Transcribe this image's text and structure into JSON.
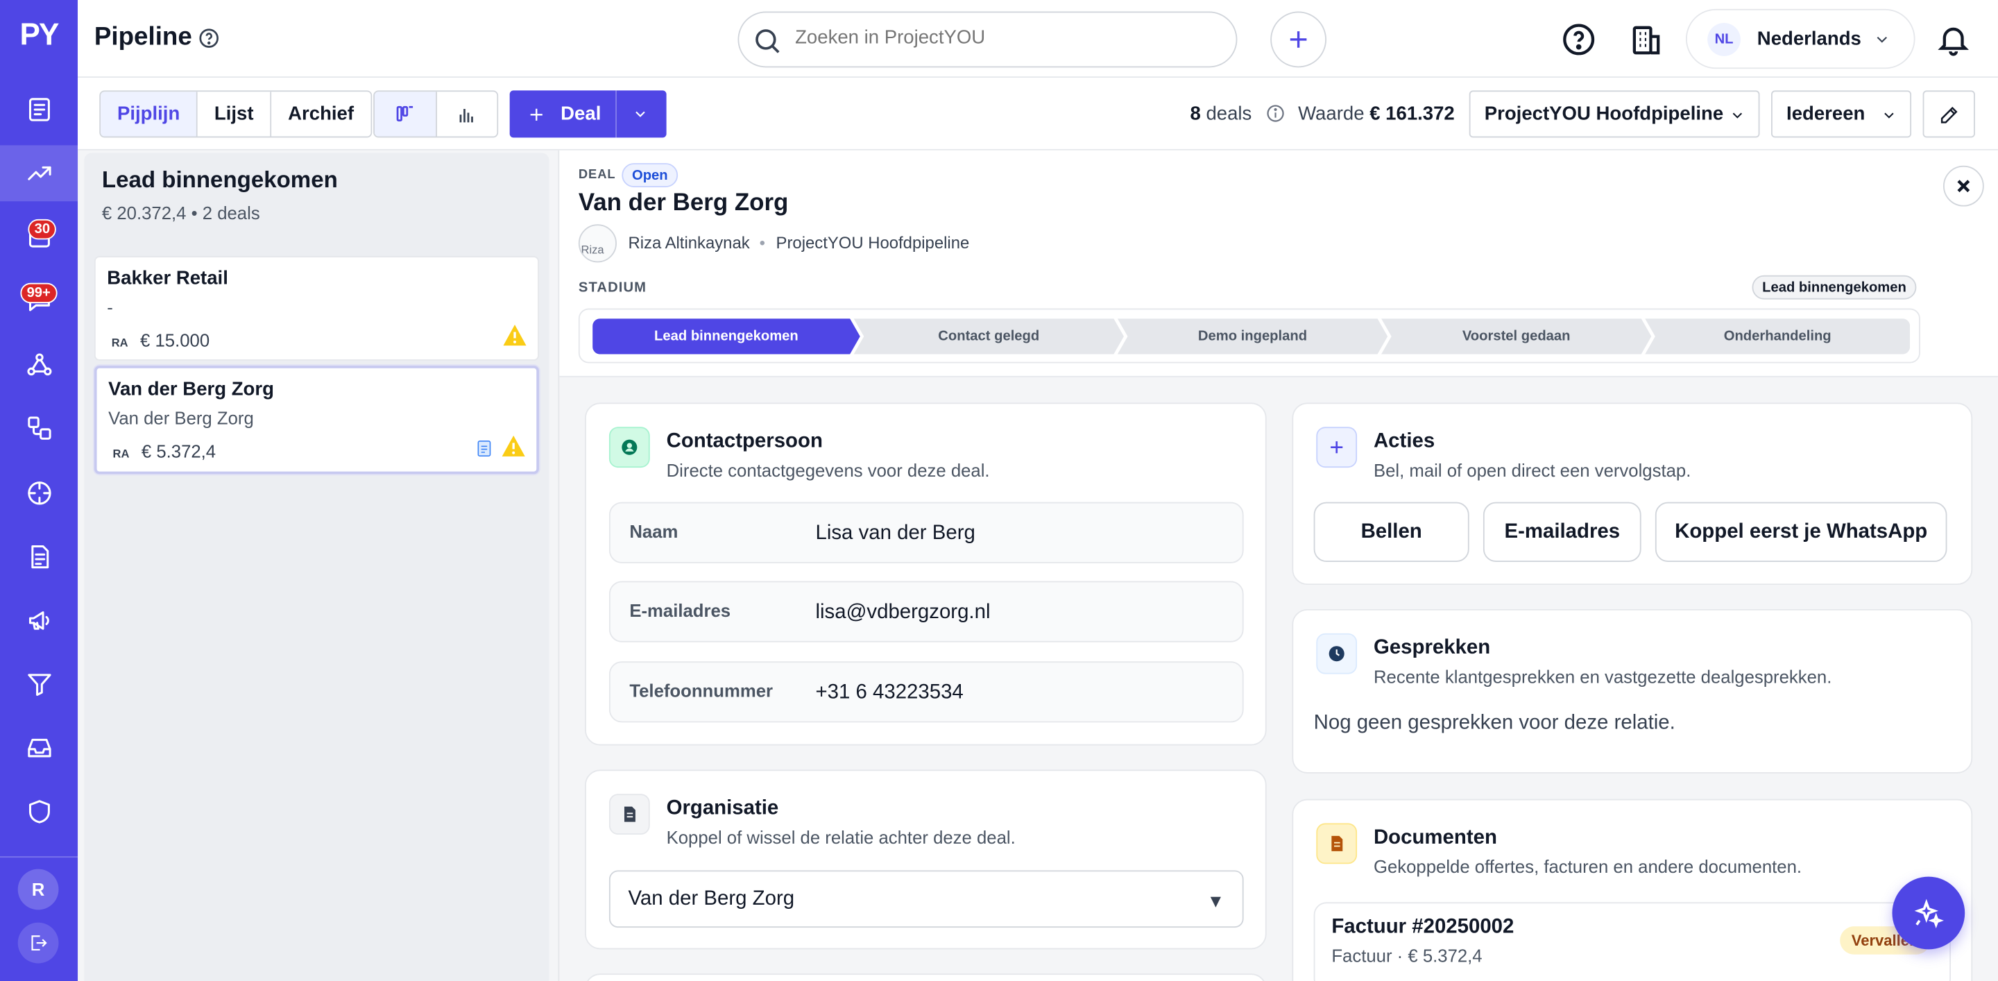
{
  "app": {
    "logo": "PY"
  },
  "sidebar": {
    "badges": {
      "calendar": "30",
      "messages": "99+"
    },
    "avatar": "R"
  },
  "topbar": {
    "title": "Pipeline",
    "search_placeholder": "Zoeken in ProjectYOU",
    "language": {
      "code": "NL",
      "label": "Nederlands"
    }
  },
  "toolbar": {
    "tabs": [
      "Pijplijn",
      "Lijst",
      "Archief"
    ],
    "deal_button": "Deal",
    "deals_count": "8",
    "deals_word": "deals",
    "value_label": "Waarde",
    "value": "€ 161.372",
    "pipeline_select": "ProjectYOU Hoofdpipeline",
    "owner_select": "Iedereen"
  },
  "column": {
    "title": "Lead binnengekomen",
    "subtitle": "€ 20.372,4 • 2 deals",
    "cards": [
      {
        "title": "Bakker Retail",
        "subtitle": "-",
        "initials": "RA",
        "value": "€ 15.000"
      },
      {
        "title": "Van der Berg Zorg",
        "subtitle": "Van der Berg Zorg",
        "initials": "RA",
        "value": "€ 5.372,4"
      }
    ]
  },
  "deal": {
    "label": "DEAL",
    "status": "Open",
    "title": "Van der Berg Zorg",
    "owner_alt": "Riza",
    "owner": "Riza Altinkaynak",
    "pipeline": "ProjectYOU Hoofdpipeline",
    "stadium_label": "STADIUM",
    "current_stage": "Lead binnengekomen",
    "stages": [
      "Lead binnengekomen",
      "Contact gelegd",
      "Demo ingepland",
      "Voorstel gedaan",
      "Onderhandeling"
    ]
  },
  "contact": {
    "title": "Contactpersoon",
    "subtitle": "Directe contactgegevens voor deze deal.",
    "fields": [
      {
        "label": "Naam",
        "value": "Lisa van der Berg"
      },
      {
        "label": "E-mailadres",
        "value": "lisa@vdbergzorg.nl"
      },
      {
        "label": "Telefoonnummer",
        "value": "+31 6 43223534"
      }
    ]
  },
  "organisation": {
    "title": "Organisatie",
    "subtitle": "Koppel of wissel de relatie achter deze deal.",
    "selected": "Van der Berg Zorg"
  },
  "actions": {
    "title": "Acties",
    "subtitle": "Bel, mail of open direct een vervolgstap.",
    "buttons": [
      "Bellen",
      "E-mailadres",
      "Koppel eerst je WhatsApp"
    ]
  },
  "conversations": {
    "title": "Gesprekken",
    "subtitle": "Recente klantgesprekken en vastgezette dealgesprekken.",
    "empty": "Nog geen gesprekken voor deze relatie."
  },
  "documents": {
    "title": "Documenten",
    "subtitle": "Gekoppelde offertes, facturen en andere documenten.",
    "items": [
      {
        "title": "Factuur #20250002",
        "meta": "Factuur · € 5.372,4",
        "status": "Vervallen"
      }
    ]
  },
  "colors": {
    "accent": "#4f46e5",
    "warning": "#facc15"
  }
}
